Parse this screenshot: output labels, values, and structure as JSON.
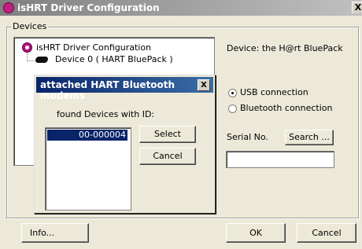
{
  "window": {
    "title": "isHRT Driver Configuration",
    "close_glyph": "X"
  },
  "devices_group": {
    "label": "Devices",
    "tree": {
      "root_label": "isHRT Driver Configuration",
      "child_label": "Device 0  ( HART BluePack )"
    },
    "device_info": "Device:   the H@rt BluePack",
    "connection": {
      "usb_label": "USB connection",
      "bluetooth_label": "Bluetooth connection",
      "selected": "usb"
    },
    "serial_label": "Serial No.",
    "search_button": "Search ...",
    "serial_value": ""
  },
  "footer": {
    "info_button": "Info...",
    "ok_button": "OK",
    "cancel_button": "Cancel"
  },
  "popup": {
    "title": "attached HART Bluetooth modems",
    "close_glyph": "X",
    "found_label": "found Devices with ID:",
    "devices": [
      "00-000004"
    ],
    "select_button": "Select",
    "cancel_button": "Cancel"
  },
  "colors": {
    "popup_title": "#0a246a",
    "selection": "#0a246a",
    "app_icon": "#c02080"
  }
}
